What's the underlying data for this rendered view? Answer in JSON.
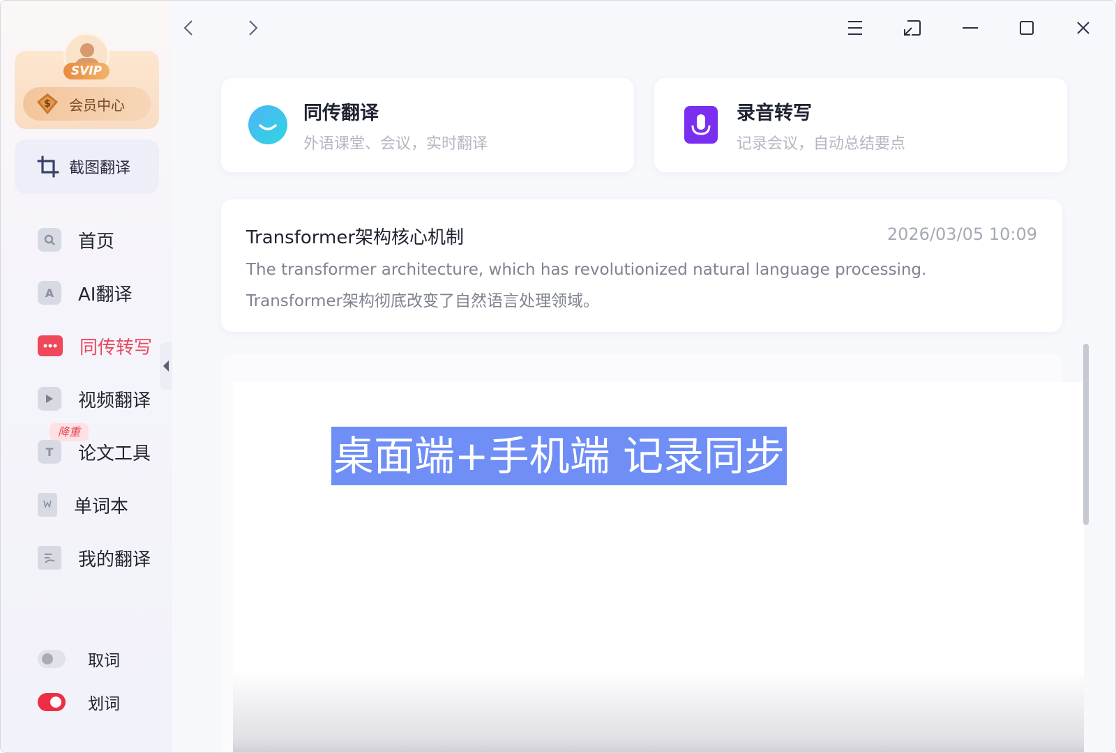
{
  "window": {
    "back_icon": "chevron-left-icon",
    "forward_icon": "chevron-right-icon",
    "controls": [
      "menu-icon",
      "mini-window-icon",
      "minimize-icon",
      "maximize-icon",
      "close-icon"
    ]
  },
  "sidebar": {
    "vip_badge": "SVIP",
    "member_center": "会员中心",
    "screenshot_translate": "截图翻译",
    "nav": [
      {
        "label": "首页",
        "icon": "home-search-icon"
      },
      {
        "label": "AI翻译",
        "icon": "ai-icon"
      },
      {
        "label": "同传转写",
        "icon": "chat-bubble-icon",
        "active": true
      },
      {
        "label": "视频翻译",
        "icon": "video-play-icon"
      },
      {
        "label": "论文工具",
        "icon": "text-t-icon"
      },
      {
        "label": "单词本",
        "icon": "bookmark-icon"
      },
      {
        "label": "我的翻译",
        "icon": "document-icon"
      }
    ],
    "paper_badge": "降重",
    "toggles": [
      {
        "label": "取词",
        "on": false
      },
      {
        "label": "划词",
        "on": true
      }
    ],
    "accent_color": "#e9495e"
  },
  "features": [
    {
      "title": "同传翻译",
      "subtitle": "外语课堂、会议，实时翻译",
      "icon": "chat-smile-icon"
    },
    {
      "title": "录音转写",
      "subtitle": "记录会议，自动总结要点",
      "icon": "microphone-icon"
    }
  ],
  "record": {
    "title": "Transformer架构核心机制",
    "timestamp": "2026/03/05 10:09",
    "line_en": "The transformer architecture, which has revolutionized natural language processing.",
    "line_zh": "Transformer架构彻底改变了自然语言处理领域。"
  },
  "promo": {
    "highlight_text": "桌面端+手机端 记录同步",
    "highlight_color": "#6f8ef6"
  }
}
